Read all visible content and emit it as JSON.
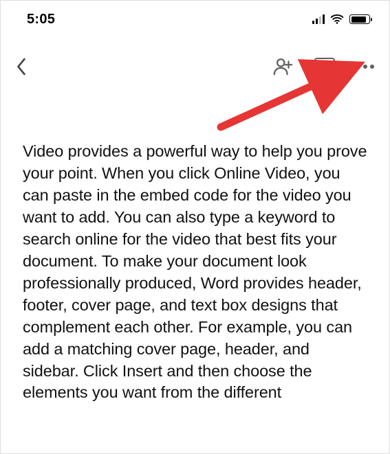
{
  "status_bar": {
    "time": "5:05",
    "cell_icon": "cell-signal-icon",
    "wifi_icon": "wifi-icon",
    "battery_icon": "battery-icon"
  },
  "toolbar": {
    "back_icon": "chevron-left-icon",
    "add_person_icon": "person-add-icon",
    "document_icon": "document-lines-icon",
    "more_icon": "more-horizontal-icon"
  },
  "document": {
    "body": "Video provides a powerful way to help you prove your point. When you click Online Video, you can paste in the embed code for the video you want to add. You can also type a keyword to search online for the video that best fits your document. To make your document look professionally produced, Word provides header, footer, cover page, and text box designs that complement each other. For example, you can add a matching cover page, header, and sidebar. Click Insert and then choose the elements you want from the different"
  },
  "annotation": {
    "arrow_color": "#e63535"
  }
}
